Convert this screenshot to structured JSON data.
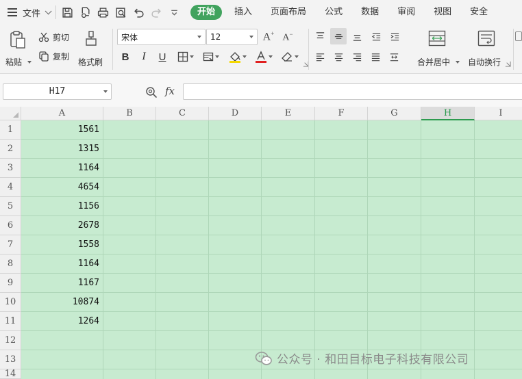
{
  "menubar": {
    "file_label": "文件",
    "tabs": [
      {
        "label": "开始",
        "active": true
      },
      {
        "label": "插入"
      },
      {
        "label": "页面布局"
      },
      {
        "label": "公式"
      },
      {
        "label": "数据"
      },
      {
        "label": "审阅"
      },
      {
        "label": "视图"
      },
      {
        "label": "安全"
      }
    ]
  },
  "ribbon": {
    "paste_label": "粘贴",
    "cut_label": "剪切",
    "copy_label": "复制",
    "format_painter_label": "格式刷",
    "font_name": "宋体",
    "font_size": "12",
    "merge_center_label": "合并居中",
    "wrap_text_label": "自动换行",
    "colors": {
      "accent": "#41a35e",
      "font_color": "#e02020",
      "fill_color": "#f5d800"
    }
  },
  "formula_bar": {
    "cell_ref": "H17",
    "fx_label": "fx",
    "formula": ""
  },
  "sheet": {
    "columns": [
      "A",
      "B",
      "C",
      "D",
      "E",
      "F",
      "G",
      "H",
      "I"
    ],
    "selected_column": "H",
    "rows": [
      "1",
      "2",
      "3",
      "4",
      "5",
      "6",
      "7",
      "8",
      "9",
      "10",
      "11",
      "12",
      "13",
      "14"
    ],
    "column_a_values": [
      "1561",
      "1315",
      "1164",
      "4654",
      "1156",
      "2678",
      "1558",
      "1164",
      "1167",
      "10874",
      "1264"
    ],
    "cell_fill": "#c7ebd0"
  },
  "watermark": {
    "text": "公众号 · 和田目标电子科技有限公司"
  }
}
